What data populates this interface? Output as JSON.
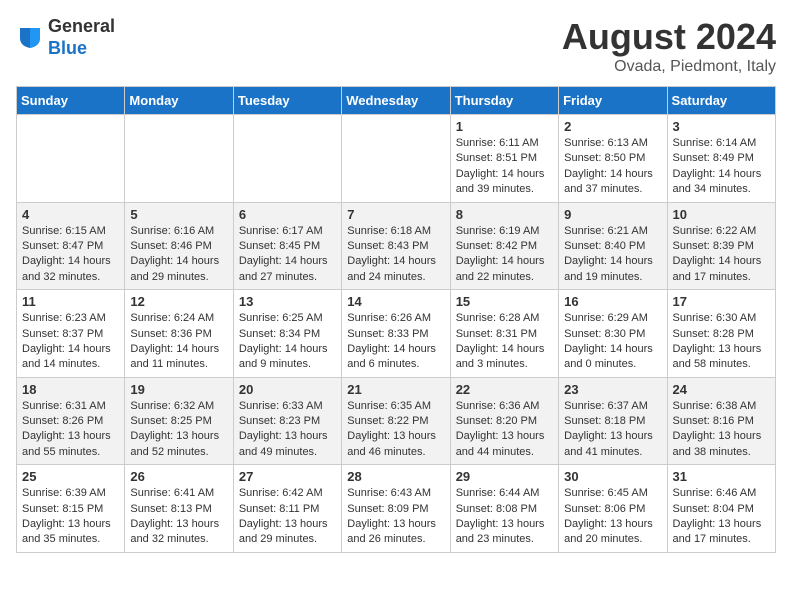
{
  "header": {
    "logo_line1": "General",
    "logo_line2": "Blue",
    "month": "August 2024",
    "location": "Ovada, Piedmont, Italy"
  },
  "weekdays": [
    "Sunday",
    "Monday",
    "Tuesday",
    "Wednesday",
    "Thursday",
    "Friday",
    "Saturday"
  ],
  "weeks": [
    [
      {
        "day": "",
        "info": ""
      },
      {
        "day": "",
        "info": ""
      },
      {
        "day": "",
        "info": ""
      },
      {
        "day": "",
        "info": ""
      },
      {
        "day": "1",
        "info": "Sunrise: 6:11 AM\nSunset: 8:51 PM\nDaylight: 14 hours and 39 minutes."
      },
      {
        "day": "2",
        "info": "Sunrise: 6:13 AM\nSunset: 8:50 PM\nDaylight: 14 hours and 37 minutes."
      },
      {
        "day": "3",
        "info": "Sunrise: 6:14 AM\nSunset: 8:49 PM\nDaylight: 14 hours and 34 minutes."
      }
    ],
    [
      {
        "day": "4",
        "info": "Sunrise: 6:15 AM\nSunset: 8:47 PM\nDaylight: 14 hours and 32 minutes."
      },
      {
        "day": "5",
        "info": "Sunrise: 6:16 AM\nSunset: 8:46 PM\nDaylight: 14 hours and 29 minutes."
      },
      {
        "day": "6",
        "info": "Sunrise: 6:17 AM\nSunset: 8:45 PM\nDaylight: 14 hours and 27 minutes."
      },
      {
        "day": "7",
        "info": "Sunrise: 6:18 AM\nSunset: 8:43 PM\nDaylight: 14 hours and 24 minutes."
      },
      {
        "day": "8",
        "info": "Sunrise: 6:19 AM\nSunset: 8:42 PM\nDaylight: 14 hours and 22 minutes."
      },
      {
        "day": "9",
        "info": "Sunrise: 6:21 AM\nSunset: 8:40 PM\nDaylight: 14 hours and 19 minutes."
      },
      {
        "day": "10",
        "info": "Sunrise: 6:22 AM\nSunset: 8:39 PM\nDaylight: 14 hours and 17 minutes."
      }
    ],
    [
      {
        "day": "11",
        "info": "Sunrise: 6:23 AM\nSunset: 8:37 PM\nDaylight: 14 hours and 14 minutes."
      },
      {
        "day": "12",
        "info": "Sunrise: 6:24 AM\nSunset: 8:36 PM\nDaylight: 14 hours and 11 minutes."
      },
      {
        "day": "13",
        "info": "Sunrise: 6:25 AM\nSunset: 8:34 PM\nDaylight: 14 hours and 9 minutes."
      },
      {
        "day": "14",
        "info": "Sunrise: 6:26 AM\nSunset: 8:33 PM\nDaylight: 14 hours and 6 minutes."
      },
      {
        "day": "15",
        "info": "Sunrise: 6:28 AM\nSunset: 8:31 PM\nDaylight: 14 hours and 3 minutes."
      },
      {
        "day": "16",
        "info": "Sunrise: 6:29 AM\nSunset: 8:30 PM\nDaylight: 14 hours and 0 minutes."
      },
      {
        "day": "17",
        "info": "Sunrise: 6:30 AM\nSunset: 8:28 PM\nDaylight: 13 hours and 58 minutes."
      }
    ],
    [
      {
        "day": "18",
        "info": "Sunrise: 6:31 AM\nSunset: 8:26 PM\nDaylight: 13 hours and 55 minutes."
      },
      {
        "day": "19",
        "info": "Sunrise: 6:32 AM\nSunset: 8:25 PM\nDaylight: 13 hours and 52 minutes."
      },
      {
        "day": "20",
        "info": "Sunrise: 6:33 AM\nSunset: 8:23 PM\nDaylight: 13 hours and 49 minutes."
      },
      {
        "day": "21",
        "info": "Sunrise: 6:35 AM\nSunset: 8:22 PM\nDaylight: 13 hours and 46 minutes."
      },
      {
        "day": "22",
        "info": "Sunrise: 6:36 AM\nSunset: 8:20 PM\nDaylight: 13 hours and 44 minutes."
      },
      {
        "day": "23",
        "info": "Sunrise: 6:37 AM\nSunset: 8:18 PM\nDaylight: 13 hours and 41 minutes."
      },
      {
        "day": "24",
        "info": "Sunrise: 6:38 AM\nSunset: 8:16 PM\nDaylight: 13 hours and 38 minutes."
      }
    ],
    [
      {
        "day": "25",
        "info": "Sunrise: 6:39 AM\nSunset: 8:15 PM\nDaylight: 13 hours and 35 minutes."
      },
      {
        "day": "26",
        "info": "Sunrise: 6:41 AM\nSunset: 8:13 PM\nDaylight: 13 hours and 32 minutes."
      },
      {
        "day": "27",
        "info": "Sunrise: 6:42 AM\nSunset: 8:11 PM\nDaylight: 13 hours and 29 minutes."
      },
      {
        "day": "28",
        "info": "Sunrise: 6:43 AM\nSunset: 8:09 PM\nDaylight: 13 hours and 26 minutes."
      },
      {
        "day": "29",
        "info": "Sunrise: 6:44 AM\nSunset: 8:08 PM\nDaylight: 13 hours and 23 minutes."
      },
      {
        "day": "30",
        "info": "Sunrise: 6:45 AM\nSunset: 8:06 PM\nDaylight: 13 hours and 20 minutes."
      },
      {
        "day": "31",
        "info": "Sunrise: 6:46 AM\nSunset: 8:04 PM\nDaylight: 13 hours and 17 minutes."
      }
    ]
  ]
}
